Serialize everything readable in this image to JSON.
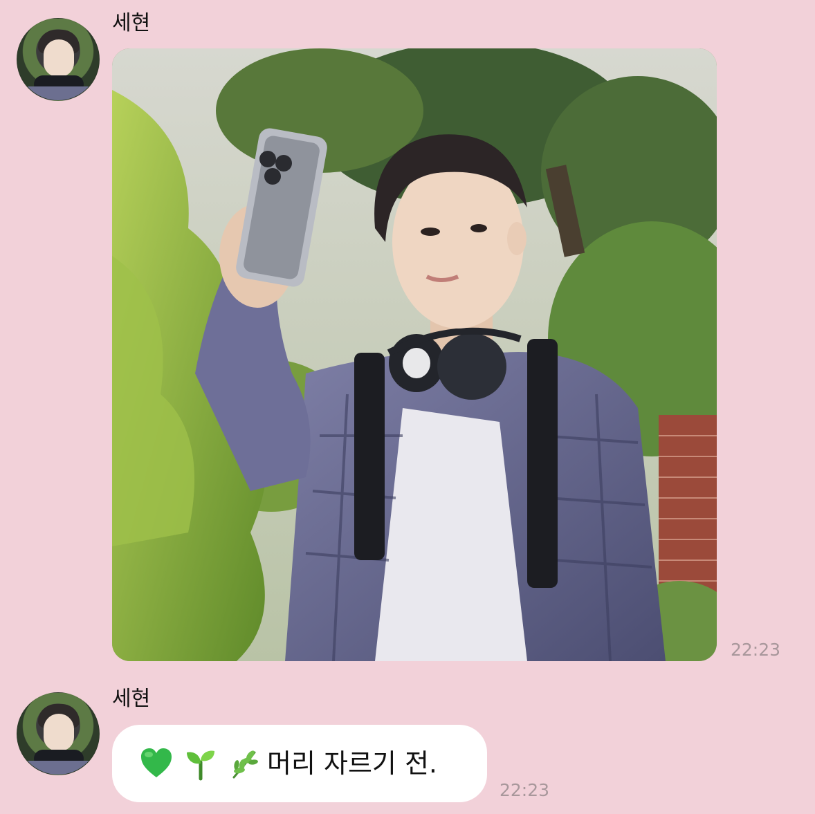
{
  "messages": [
    {
      "sender": "세현",
      "type": "image",
      "time": "22:23"
    },
    {
      "sender": "세현",
      "type": "text",
      "emojis": [
        "green-heart-icon",
        "seedling-icon",
        "herb-icon"
      ],
      "text": "머리 자르기 전.",
      "time": "22:23"
    }
  ],
  "colors": {
    "background": "#f2d1d9",
    "bubble": "#ffffff",
    "timestamp": "#a8979b"
  }
}
